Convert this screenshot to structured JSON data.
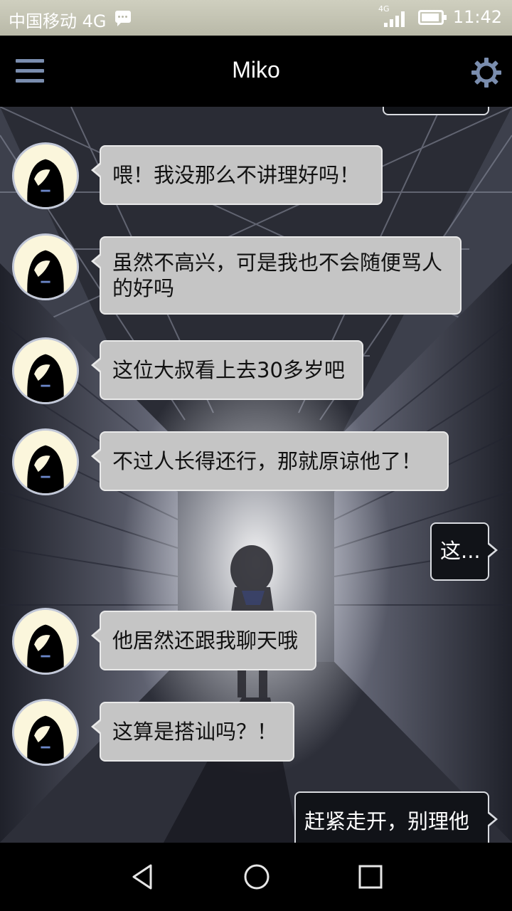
{
  "status_bar": {
    "carrier": "中国移动 4G",
    "network_type": "4G",
    "time": "11:42",
    "icons": [
      "sms-icon",
      "signal-icon",
      "battery-icon"
    ]
  },
  "app_bar": {
    "title": "Miko",
    "menu_icon": "menu-icon",
    "settings_icon": "gear-icon",
    "accent": "#7a8dae"
  },
  "messages": [
    {
      "side": "in",
      "text": "喂！我没那么不讲理好吗！"
    },
    {
      "side": "in",
      "text": "虽然不高兴，可是我也不会随便骂人的好吗"
    },
    {
      "side": "in",
      "text": "这位大叔看上去30多岁吧"
    },
    {
      "side": "in",
      "text": "不过人长得还行，那就原谅他了！"
    },
    {
      "side": "out",
      "text": "这..."
    },
    {
      "side": "in",
      "text": "他居然还跟我聊天哦"
    },
    {
      "side": "in",
      "text": "这算是搭讪吗？！"
    },
    {
      "side": "out",
      "text": "赶紧走开，别理他"
    }
  ],
  "nav_bar": {
    "icons": [
      "back-icon",
      "home-icon",
      "recents-icon"
    ]
  },
  "colors": {
    "incoming_bubble": "#c5c5c5",
    "outgoing_bubble": "#111318",
    "avatar_bg": "#fbf6dc"
  }
}
